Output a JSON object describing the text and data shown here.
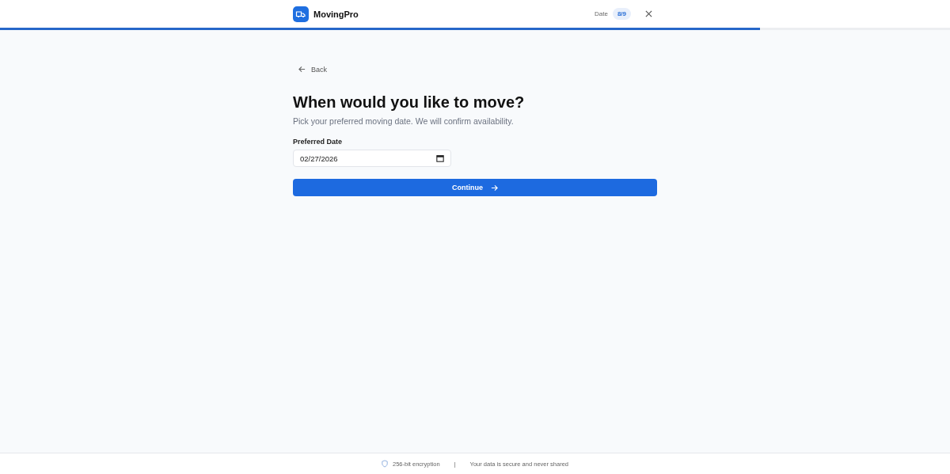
{
  "header": {
    "brand": "MovingPro",
    "step_label": "Date",
    "step_count": "8/9",
    "progress": {
      "level": 0.8
    }
  },
  "back": "Back",
  "title": "When would you like to move?",
  "subtitle": "Pick your preferred moving date. We will confirm availability.",
  "field": {
    "label": "Preferred Date",
    "value": "02/27/2026"
  },
  "button": "Continue",
  "footer": {
    "security": "256-bit encryption",
    "separator": "|",
    "note": "Your data is secure and never shared"
  }
}
